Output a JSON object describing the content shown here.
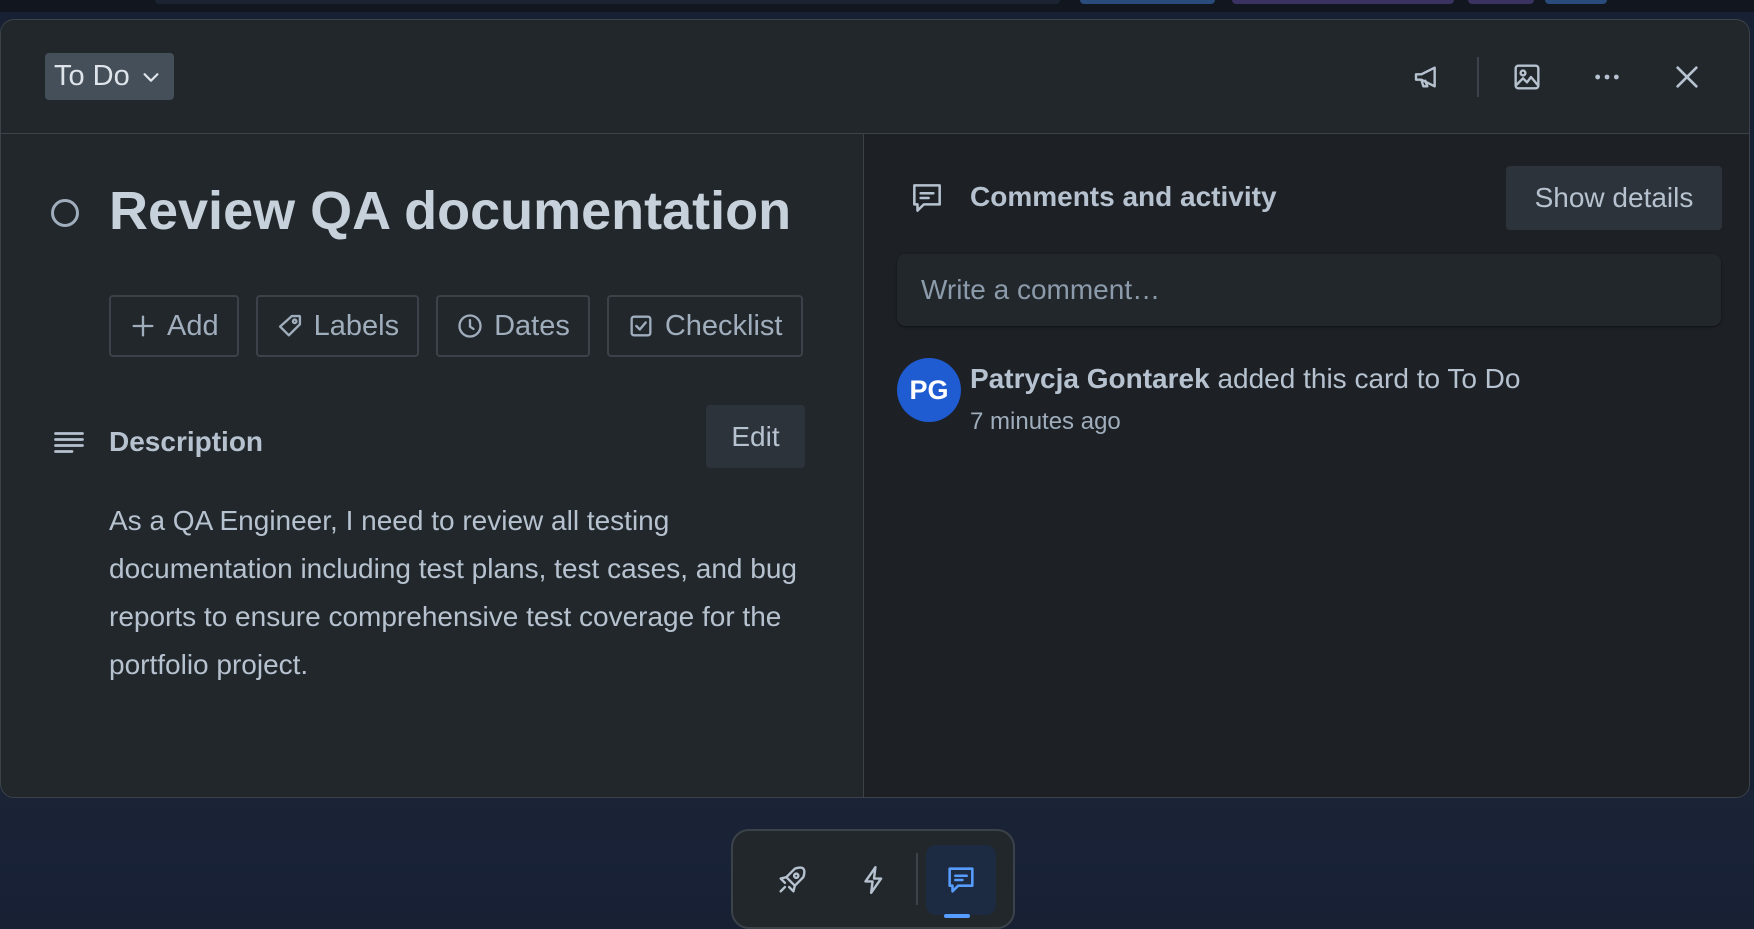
{
  "header": {
    "list_name": "To Do",
    "icons": [
      "megaphone-icon",
      "cover-image-icon",
      "more-icon",
      "close-icon"
    ]
  },
  "card": {
    "title": "Review QA documentation",
    "actions": [
      {
        "label": "Add",
        "icon": "plus-icon"
      },
      {
        "label": "Labels",
        "icon": "tag-icon"
      },
      {
        "label": "Dates",
        "icon": "clock-icon"
      },
      {
        "label": "Checklist",
        "icon": "checkbox-icon"
      }
    ],
    "description": {
      "title": "Description",
      "edit_label": "Edit",
      "text": "As a QA Engineer, I need to review all testing documentation including test plans, test cases, and bug reports to ensure comprehensive test coverage for the portfolio project."
    }
  },
  "activity": {
    "title": "Comments and activity",
    "show_details_label": "Show details",
    "comment_placeholder": "Write a comment…",
    "items": [
      {
        "avatar_initials": "PG",
        "user": "Patrycja Gontarek",
        "action": " added this card to ",
        "list": "To Do",
        "time": "7 minutes ago"
      }
    ]
  },
  "toolbar": {
    "items": [
      "rocket-icon",
      "lightning-icon",
      "comment-icon"
    ],
    "active": "comment-icon"
  },
  "colors": {
    "background": "#182033",
    "modal": "#22272b",
    "panel": "#1d2125",
    "avatar": "#1f5bd1",
    "accent": "#579dff"
  }
}
